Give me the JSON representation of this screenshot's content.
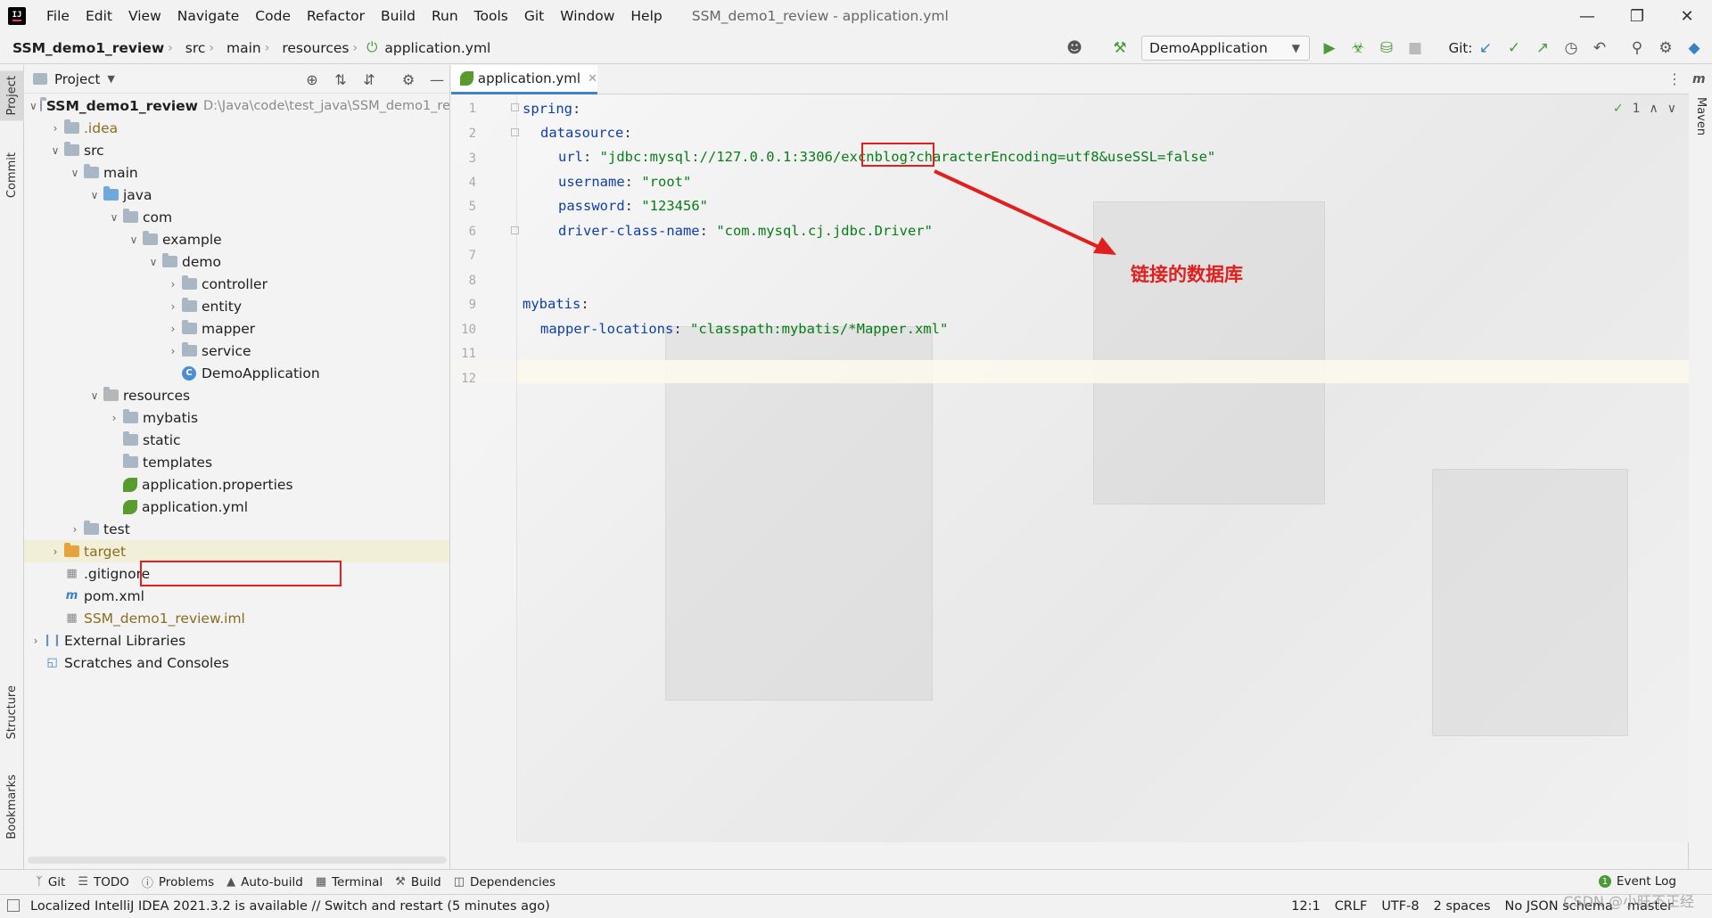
{
  "menubar": {
    "items": [
      "File",
      "Edit",
      "View",
      "Navigate",
      "Code",
      "Refactor",
      "Build",
      "Run",
      "Tools",
      "Git",
      "Window",
      "Help"
    ],
    "window_title": "SSM_demo1_review - application.yml"
  },
  "navbar": {
    "breadcrumbs": [
      "SSM_demo1_review",
      "src",
      "main",
      "resources",
      "application.yml"
    ],
    "run_config": "DemoApplication",
    "git_label": "Git:"
  },
  "left_strip": {
    "tabs": [
      "Project",
      "Commit",
      "Structure",
      "Bookmarks"
    ]
  },
  "right_strip": {
    "tabs": [
      "Maven"
    ]
  },
  "project_panel": {
    "title": "Project",
    "tree": [
      {
        "label": "SSM_demo1_review",
        "hint": "D:\\Java\\code\\test_java\\SSM_demo1_re",
        "kind": "module"
      },
      {
        "label": ".idea",
        "kind": "folder"
      },
      {
        "label": "src",
        "kind": "folder"
      },
      {
        "label": "main",
        "kind": "folder"
      },
      {
        "label": "java",
        "kind": "folder-blue"
      },
      {
        "label": "com",
        "kind": "package"
      },
      {
        "label": "example",
        "kind": "package"
      },
      {
        "label": "demo",
        "kind": "package"
      },
      {
        "label": "controller",
        "kind": "package"
      },
      {
        "label": "entity",
        "kind": "package"
      },
      {
        "label": "mapper",
        "kind": "package"
      },
      {
        "label": "service",
        "kind": "package"
      },
      {
        "label": "DemoApplication",
        "kind": "class"
      },
      {
        "label": "resources",
        "kind": "folder-res"
      },
      {
        "label": "mybatis",
        "kind": "folder"
      },
      {
        "label": "static",
        "kind": "folder"
      },
      {
        "label": "templates",
        "kind": "folder"
      },
      {
        "label": "application.properties",
        "kind": "spring"
      },
      {
        "label": "application.yml",
        "kind": "spring"
      },
      {
        "label": "test",
        "kind": "folder"
      },
      {
        "label": "target",
        "kind": "folder-orange"
      },
      {
        "label": ".gitignore",
        "kind": "file"
      },
      {
        "label": "pom.xml",
        "kind": "maven"
      },
      {
        "label": "SSM_demo1_review.iml",
        "kind": "iml"
      },
      {
        "label": "External Libraries",
        "kind": "libs"
      },
      {
        "label": "Scratches and Consoles",
        "kind": "scratch"
      }
    ]
  },
  "editor": {
    "tab_label": "application.yml",
    "line_numbers": [
      "1",
      "2",
      "3",
      "4",
      "5",
      "6",
      "7",
      "8",
      "9",
      "10",
      "11",
      "12"
    ],
    "code": {
      "l1_key": "spring",
      "l2_key": "datasource",
      "l3_key": "url",
      "l3_val_a": "\"jdbc:mysql://127.0.0.1:3306/",
      "l3_val_db": "excnblog",
      "l3_val_b": "?characterEncoding=utf8&useSSL=false\"",
      "l4_key": "username",
      "l4_val": "\"root\"",
      "l5_key": "password",
      "l5_val": "\"123456\"",
      "l6_key": "driver-class-name",
      "l6_val": "\"com.mysql.cj.jdbc.Driver\"",
      "l9_key": "mybatis",
      "l10_key": "mapper-locations",
      "l10_val": "\"classpath:mybatis/*Mapper.xml\""
    },
    "inspection_count": "1",
    "annotation": "链接的数据库"
  },
  "tool_windows": [
    "Git",
    "TODO",
    "Problems",
    "Auto-build",
    "Terminal",
    "Build",
    "Dependencies"
  ],
  "event_log": {
    "label": "Event Log",
    "count": "1"
  },
  "status_bar": {
    "message": "Localized IntelliJ IDEA 2021.3.2 is available // Switch and restart (5 minutes ago)",
    "position": "12:1",
    "line_sep": "CRLF",
    "encoding": "UTF-8",
    "indent": "2 spaces",
    "schema": "No JSON schema",
    "branch": "master"
  },
  "watermark": "CSDN @小旺不正经",
  "colors": {
    "accent": "#4083c9",
    "annotation_red": "#e0201e",
    "string_green": "#067d17",
    "key_blue": "#0e3fa8"
  }
}
